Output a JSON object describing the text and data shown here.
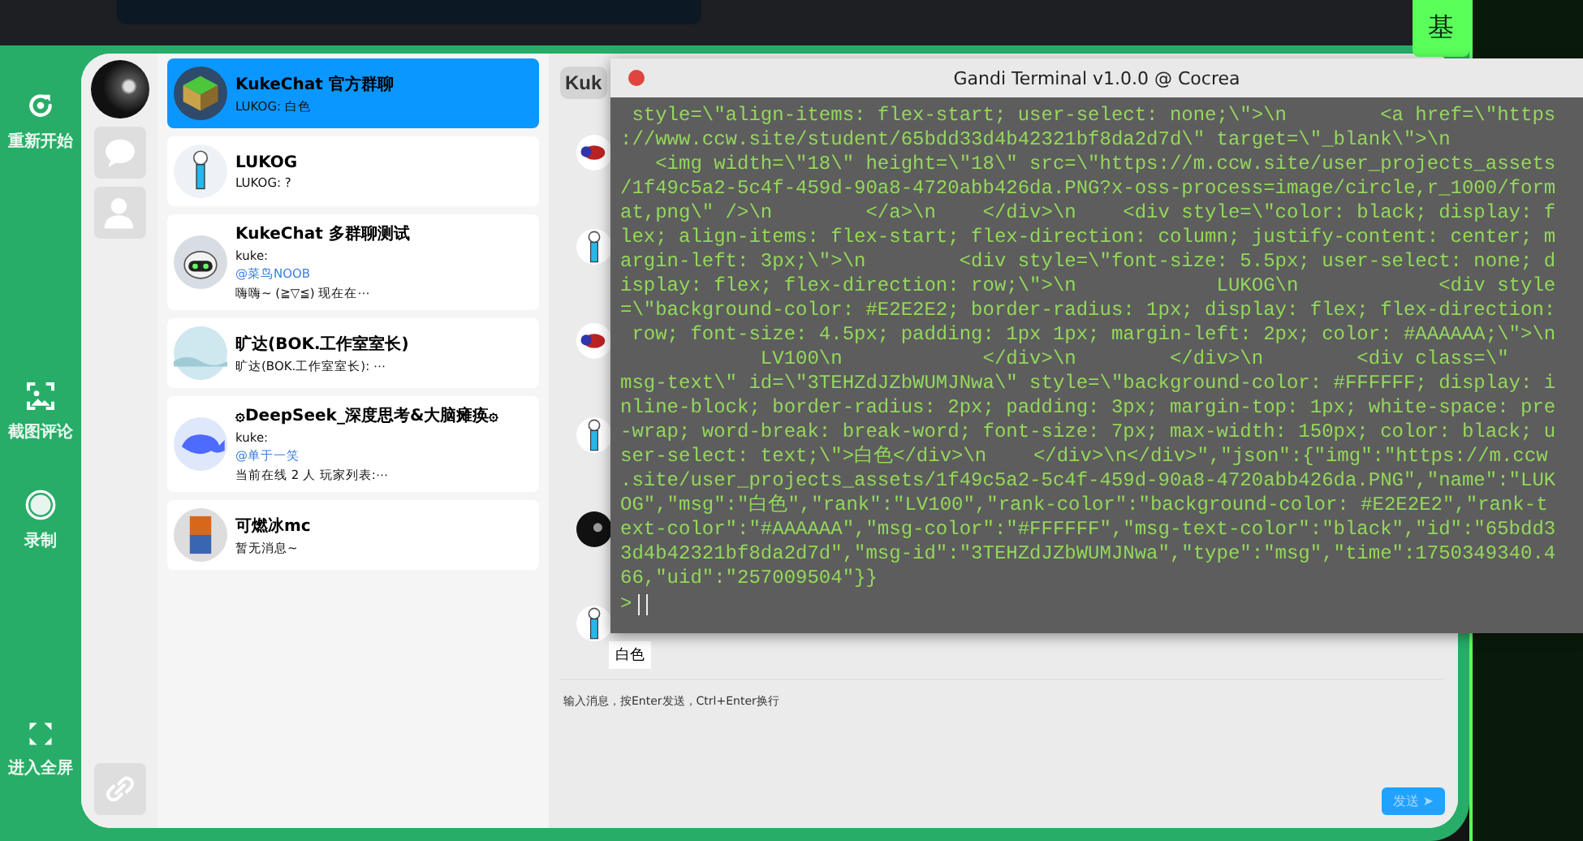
{
  "side_tab": {
    "label": "基"
  },
  "toolbar": [
    {
      "kind": "restart",
      "label": "重新开始"
    },
    {
      "kind": "screenshot",
      "label": "截图评论"
    },
    {
      "kind": "record",
      "label": "录制"
    },
    {
      "kind": "fullscreen",
      "label": "进入全屏"
    }
  ],
  "nav": [
    {
      "kind": "chats",
      "selected": false
    },
    {
      "kind": "contacts",
      "selected": false
    }
  ],
  "chat_list": [
    {
      "avatar": {
        "kind": "cube"
      },
      "name": "KukeChat 官方群聊",
      "selected": true,
      "preview": [
        {
          "kind": "text",
          "text": "LUKOG: 白色"
        }
      ]
    },
    {
      "avatar": {
        "kind": "stick"
      },
      "name": "LUKOG",
      "selected": false,
      "preview": [
        {
          "kind": "text",
          "text": "LUKOG: ?"
        }
      ]
    },
    {
      "avatar": {
        "kind": "robot"
      },
      "name": "KukeChat 多群聊测试",
      "selected": false,
      "preview": [
        {
          "kind": "text",
          "text": "kuke:"
        },
        {
          "kind": "mention",
          "text": "@菜鸟NOOB"
        },
        {
          "kind": "text",
          "text": "嗨嗨~ (≧▽≦) 现在在⋯"
        }
      ]
    },
    {
      "avatar": {
        "kind": "landscape"
      },
      "name": "旷达(BOK.工作室室长)",
      "selected": false,
      "preview": [
        {
          "kind": "text",
          "text": "旷达(BOK.工作室室长): ⋯"
        }
      ]
    },
    {
      "avatar": {
        "kind": "whale"
      },
      "name": "۞DeepSeek_深度思考&大脑瘫痪۞",
      "selected": false,
      "preview": [
        {
          "kind": "text",
          "text": "kuke:"
        },
        {
          "kind": "mention",
          "text": "@单于一笑"
        },
        {
          "kind": "text",
          "text": "当前在线 2 人 玩家列表:⋯"
        }
      ]
    },
    {
      "avatar": {
        "kind": "block"
      },
      "name": "可燃冰mc",
      "selected": false,
      "preview": [
        {
          "kind": "text",
          "text": "暂无消息~"
        }
      ]
    }
  ],
  "chat": {
    "header": "Kuk",
    "messages": [
      {
        "avatar": {
          "kind": "ladybug"
        }
      },
      {
        "avatar": {
          "kind": "stick"
        }
      },
      {
        "avatar": {
          "kind": "ladybug"
        }
      },
      {
        "avatar": {
          "kind": "stick"
        }
      },
      {
        "avatar": {
          "kind": "dark"
        }
      },
      {
        "avatar": {
          "kind": "stick"
        },
        "text": "白色"
      }
    ],
    "input": {
      "placeholder": "输入消息，按Enter发送，Ctrl+Enter换行"
    },
    "send_button": "发送 ➤"
  },
  "terminal": {
    "title": "Gandi Terminal v1.0.0 @ Cocrea",
    "lines": [
      " style=\\\"align-items: flex-start; user-select: none;\\\">\\n        <a href=\\\"https",
      "://www.ccw.site/student/65bdd33d4b42321bf8da2d7d\\\" target=\\\"_blank\\\">\\n",
      "   <img width=\\\"18\\\" height=\\\"18\\\" src=\\\"https://m.ccw.site/user_projects_assets",
      "/1f49c5a2-5c4f-459d-90a8-4720abb426da.PNG?x-oss-process=image/circle,r_1000/form",
      "at,png\\\" />\\n        </a>\\n    </div>\\n    <div style=\\\"color: black; display: f",
      "lex; align-items: flex-start; flex-direction: column; justify-content: center; m",
      "argin-left: 3px;\\\">\\n        <div style=\\\"font-size: 5.5px; user-select: none; d",
      "isplay: flex; flex-direction: row;\\\">\\n            LUKOG\\n            <div style",
      "=\\\"background-color: #E2E2E2; border-radius: 1px; display: flex; flex-direction:",
      " row; font-size: 4.5px; padding: 1px 1px; margin-left: 2px; color: #AAAAAA;\\\">\\n",
      "            LV100\\n            </div>\\n        </div>\\n        <div class=\\\"",
      "msg-text\\\" id=\\\"3TEHZdJZbWUMJNwa\\\" style=\\\"background-color: #FFFFFF; display: i",
      "nline-block; border-radius: 2px; padding: 3px; margin-top: 1px; white-space: pre",
      "-wrap; word-break: break-word; font-size: 7px; max-width: 150px; color: black; u",
      "ser-select: text;\\\">白色</div>\\n    </div>\\n</div>\",\"json\":{\"img\":\"https://m.ccw",
      ".site/user_projects_assets/1f49c5a2-5c4f-459d-90a8-4720abb426da.PNG\",\"name\":\"LUK",
      "OG\",\"msg\":\"白色\",\"rank\":\"LV100\",\"rank-color\":\"background-color: #E2E2E2\",\"rank-t",
      "ext-color\":\"#AAAAAA\",\"msg-color\":\"#FFFFFF\",\"msg-text-color\":\"black\",\"id\":\"65bdd3",
      "3d4b42321bf8da2d7d\",\"msg-id\":\"3TEHZdJZbWUMJNwa\",\"type\":\"msg\",\"time\":1750349340.4",
      "66,\"uid\":\"257009504\"}}"
    ],
    "prompt": ">"
  }
}
